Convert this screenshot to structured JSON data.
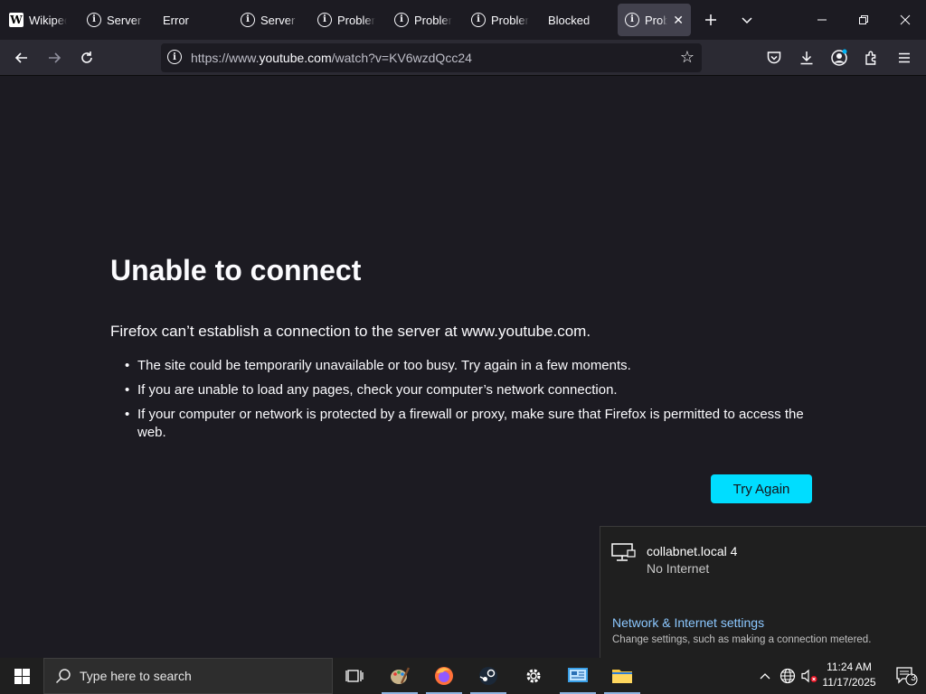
{
  "tabs": [
    {
      "title": "Wikipedia",
      "icon": "wikipedia-icon"
    },
    {
      "title": "Server Not Found",
      "icon": "info-icon"
    },
    {
      "title": "Error",
      "icon": ""
    },
    {
      "title": "Server Not Found",
      "icon": "info-icon"
    },
    {
      "title": "Problem loading page",
      "icon": "info-icon"
    },
    {
      "title": "Problem loading page",
      "icon": "info-icon"
    },
    {
      "title": "Problem loading page",
      "icon": "info-icon"
    },
    {
      "title": "Blocked",
      "icon": ""
    },
    {
      "title": "Problem loading page",
      "icon": "info-icon",
      "active": true
    }
  ],
  "urlbar": {
    "scheme": "https://www.",
    "host": "youtube.com",
    "path": "/watch?v=KV6wzdQcc24"
  },
  "error": {
    "title": "Unable to connect",
    "description": "Firefox can’t establish a connection to the server at www.youtube.com.",
    "items": [
      "The site could be temporarily unavailable or too busy. Try again in a few moments.",
      "If you are unable to load any pages, check your computer’s network connection.",
      "If your computer or network is protected by a firewall or proxy, make sure that Firefox is permitted to access the web."
    ],
    "try_again_label": "Try Again"
  },
  "network_flyout": {
    "network_name": "collabnet.local 4",
    "status": "No Internet",
    "settings_link": "Network & Internet settings",
    "settings_desc": "Change settings, such as making a connection metered."
  },
  "taskbar": {
    "search_placeholder": "Type here to search",
    "time": "11:24 AM",
    "date": "11/17/2025",
    "notification_count": "3"
  },
  "colors": {
    "accent": "#00ddff",
    "background": "#1c1b22",
    "toolbar": "#2b2a33"
  }
}
